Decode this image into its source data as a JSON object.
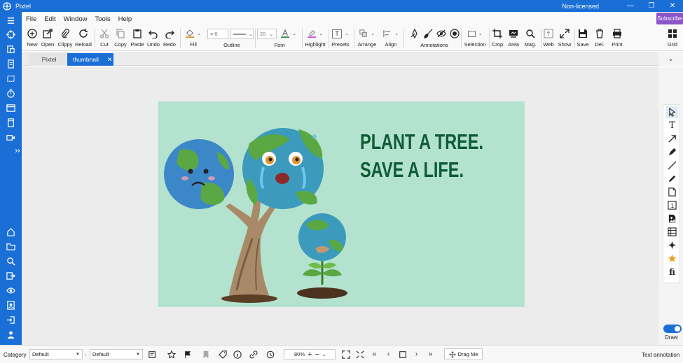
{
  "app": {
    "title": "Pixtel",
    "license": "Non-licensed",
    "subscribe_label": "Subscribe"
  },
  "menu": [
    "File",
    "Edit",
    "Window",
    "Tools",
    "Help"
  ],
  "toolbar": {
    "new": "New",
    "open": "Open",
    "clippy": "Clippy",
    "reload": "Reload",
    "cut": "Cut",
    "copy": "Copy",
    "paste": "Paste",
    "undo": "Undo",
    "redo": "Redo",
    "fill": "Fill",
    "outline": "Outline",
    "outline_width": "6",
    "font": "Font",
    "font_size": "20",
    "highlight": "Highlight",
    "presets": "Presets",
    "arrange": "Arrange",
    "align": "Align",
    "annotations": "Annotations",
    "selection": "Selection",
    "crop": "Crop",
    "area": "Area",
    "mag": "Mag.",
    "web": "Web",
    "show": "Show",
    "save": "Save",
    "del": "Del.",
    "print": "Print",
    "grid": "Grid"
  },
  "tabs": [
    {
      "label": "Pixtel",
      "active": false
    },
    {
      "label": "thumbnail",
      "active": true
    }
  ],
  "artboard": {
    "headline_line1": "PLANT A TREE.",
    "headline_line2": "SAVE A LIFE.",
    "background": "#b3e2cf",
    "text_color": "#0e5b35"
  },
  "right_panel": {
    "draw_label": "Draw",
    "draw_enabled": true
  },
  "status": {
    "category_label": "Category",
    "category_value": "Default",
    "category_separator": "-",
    "style_value": "Default",
    "zoom": "80%",
    "drag_label": "Drag Me",
    "hint": "Text annotation"
  },
  "colors": {
    "accent": "#1a6fd6",
    "subscribe": "#8b55c9"
  }
}
